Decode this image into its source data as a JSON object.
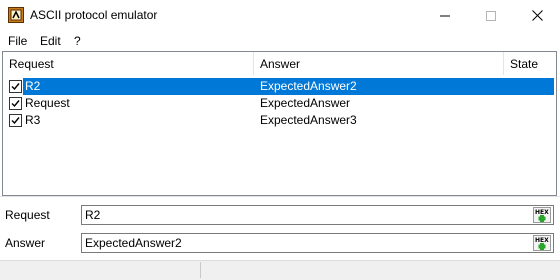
{
  "window": {
    "title": "ASCII protocol emulator"
  },
  "menu": {
    "items": [
      "File",
      "Edit",
      "?"
    ]
  },
  "table": {
    "columns": [
      "Request",
      "Answer",
      "State"
    ],
    "rows": [
      {
        "request": "R2",
        "answer": "ExpectedAnswer2",
        "state": "",
        "checked": true,
        "selected": true
      },
      {
        "request": "Request",
        "answer": "ExpectedAnswer",
        "state": "",
        "checked": true,
        "selected": false
      },
      {
        "request": "R3",
        "answer": "ExpectedAnswer3",
        "state": "",
        "checked": true,
        "selected": false
      }
    ]
  },
  "form": {
    "request_label": "Request",
    "request_value": "R2",
    "answer_label": "Answer",
    "answer_value": "ExpectedAnswer2",
    "hex_icon": "hex-add-icon"
  },
  "colors": {
    "selection": "#0078d7",
    "hex_plus": "#2aa52a"
  }
}
